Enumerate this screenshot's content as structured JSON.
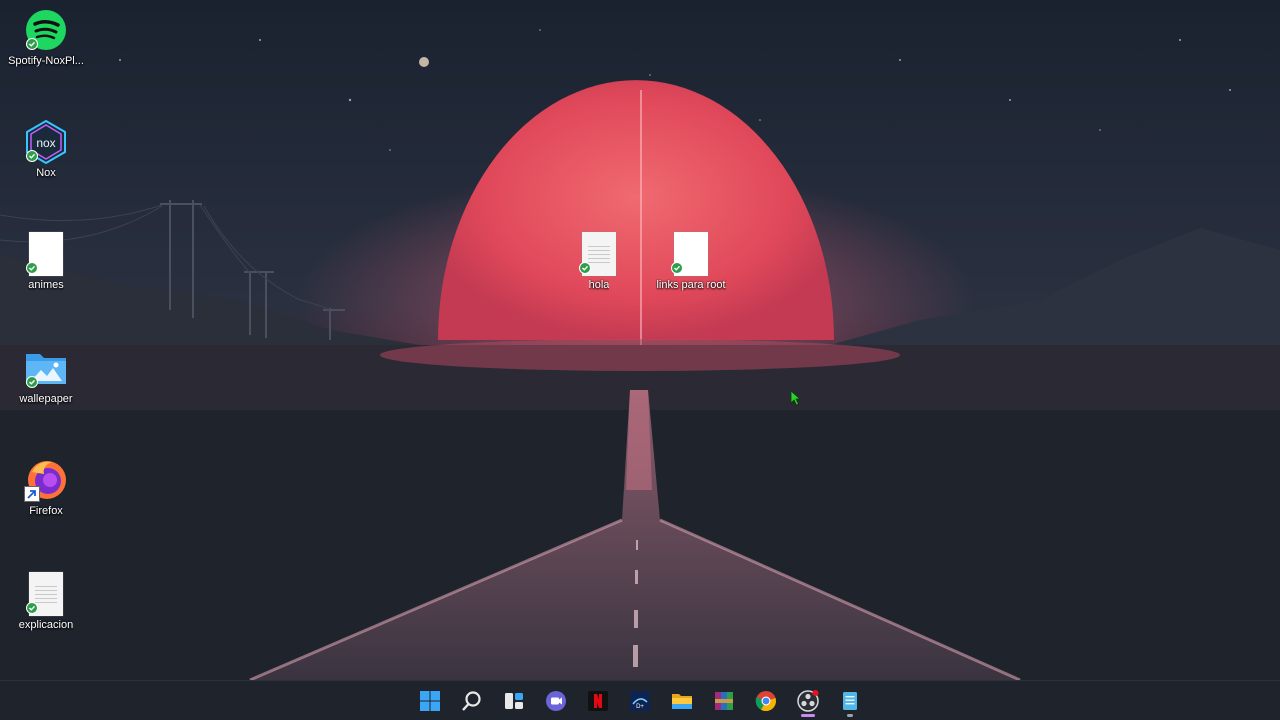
{
  "desktop": {
    "icons": [
      {
        "id": "spotify",
        "label": "Spotify-NoxPl...",
        "icon": "spotify-icon"
      },
      {
        "id": "nox",
        "label": "Nox",
        "icon": "nox-icon"
      },
      {
        "id": "animes",
        "label": "animes",
        "icon": "blank-document-icon"
      },
      {
        "id": "wallepaper",
        "label": "wallepaper",
        "icon": "folder-icon"
      },
      {
        "id": "firefox",
        "label": "Firefox",
        "icon": "firefox-icon"
      },
      {
        "id": "explicacion",
        "label": "explicacion",
        "icon": "text-document-icon"
      },
      {
        "id": "hola",
        "label": "hola",
        "icon": "text-document-icon"
      },
      {
        "id": "links",
        "label": "links para root",
        "icon": "blank-document-icon"
      }
    ]
  },
  "taskbar": {
    "items": [
      {
        "name": "start-button",
        "icon": "windows-logo-icon"
      },
      {
        "name": "search-button",
        "icon": "search-icon"
      },
      {
        "name": "task-view-button",
        "icon": "task-view-icon"
      },
      {
        "name": "teams-chat-button",
        "icon": "chat-icon"
      },
      {
        "name": "netflix-button",
        "icon": "netflix-icon"
      },
      {
        "name": "disney-plus-button",
        "icon": "disney-plus-icon"
      },
      {
        "name": "file-explorer-button",
        "icon": "folder-icon"
      },
      {
        "name": "winrar-button",
        "icon": "winrar-icon"
      },
      {
        "name": "chrome-button",
        "icon": "chrome-icon"
      },
      {
        "name": "obs-button",
        "icon": "obs-icon"
      },
      {
        "name": "notepad-button",
        "icon": "notepad-icon"
      }
    ]
  },
  "colors": {
    "moon": "#e0485a",
    "sky": "#1f2733",
    "accent": "#c58cf0"
  }
}
